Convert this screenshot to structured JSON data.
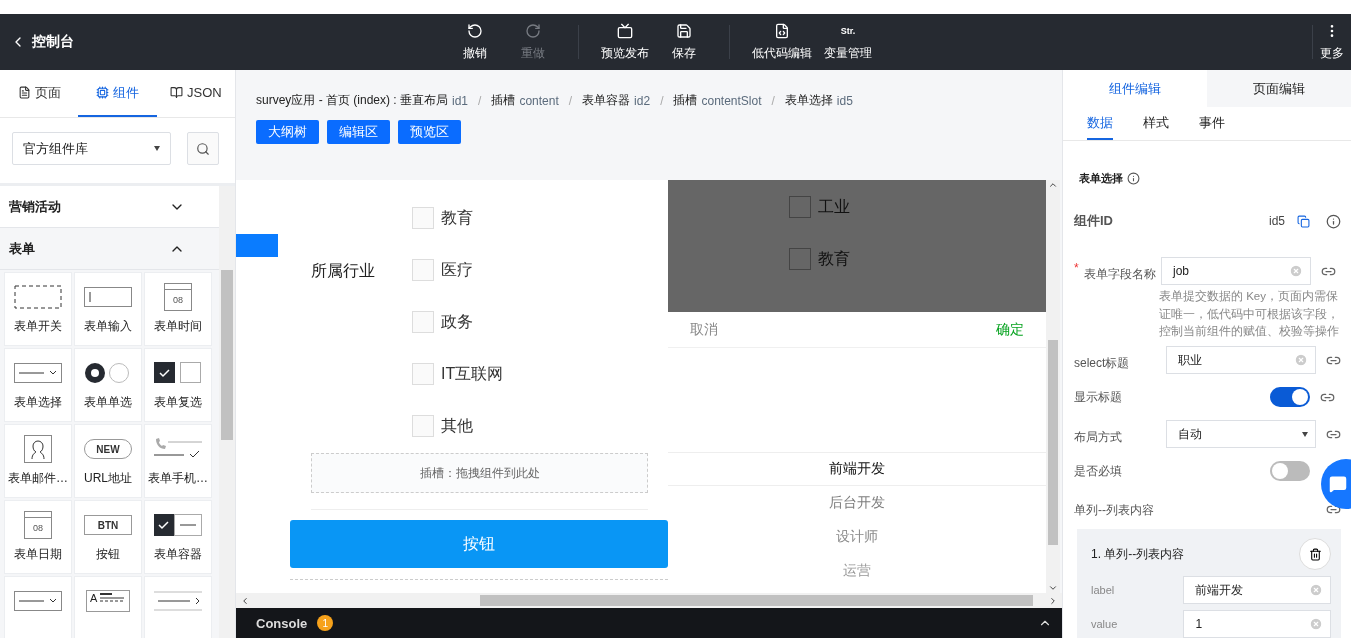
{
  "header": {
    "back": "控制台",
    "groups": [
      [
        {
          "label": "撤销",
          "kind": "undo",
          "disabled": false
        },
        {
          "label": "重做",
          "kind": "redo",
          "disabled": true
        }
      ],
      [
        {
          "label": "预览发布",
          "kind": "preview",
          "disabled": false
        },
        {
          "label": "保存",
          "kind": "save",
          "disabled": false
        }
      ],
      [
        {
          "label": "低代码编辑",
          "kind": "code",
          "disabled": false
        },
        {
          "label": "变量管理",
          "kind": "text",
          "glyph": "Str.",
          "disabled": false
        }
      ]
    ],
    "more": "更多"
  },
  "left_panel": {
    "tabs": [
      {
        "label": "页面",
        "kind": "page",
        "selected": false
      },
      {
        "label": "组件",
        "kind": "chip",
        "selected": true
      },
      {
        "label": "JSON",
        "kind": "book",
        "selected": false
      }
    ],
    "library": "官方组件库",
    "categories": [
      {
        "title": "营销活动",
        "expanded": false
      },
      {
        "title": "表单",
        "expanded": true
      }
    ],
    "components": [
      {
        "label": "表单开关",
        "kind": "dashed"
      },
      {
        "label": "表单输入",
        "kind": "input"
      },
      {
        "label": "表单时间",
        "kind": "calendar",
        "glyph": "08"
      },
      {
        "label": "表单选择",
        "kind": "select"
      },
      {
        "label": "表单单选",
        "kind": "radio"
      },
      {
        "label": "表单复选",
        "kind": "checkbox"
      },
      {
        "label": "表单邮件…",
        "kind": "person"
      },
      {
        "label": "URL地址",
        "kind": "pill",
        "glyph": "NEW"
      },
      {
        "label": "表单手机…",
        "kind": "phone"
      },
      {
        "label": "表单日期",
        "kind": "calendar",
        "glyph": "08"
      },
      {
        "label": "按钮",
        "kind": "btn",
        "glyph": "BTN"
      },
      {
        "label": "表单容器",
        "kind": "container"
      },
      {
        "kind": "select"
      },
      {
        "kind": "textarea",
        "glyph": "A"
      },
      {
        "kind": "arrowline"
      }
    ]
  },
  "breadcrumb": [
    {
      "name": "survey应用 - 首页 (index) : 垂直布局",
      "id": "id1"
    },
    {
      "sep": "/",
      "name": "插槽",
      "id": "content"
    },
    {
      "sep": "/",
      "name": "表单容器",
      "id": "id2"
    },
    {
      "sep": "/",
      "name": "插槽",
      "id": "contentSlot"
    },
    {
      "sep": "/",
      "name": "表单选择",
      "id": "id5"
    }
  ],
  "view_buttons": [
    "大纲树",
    "编辑区",
    "预览区"
  ],
  "form": {
    "label": "所属行业",
    "options": [
      {
        "label": "教育",
        "checked": false
      },
      {
        "label": "医疗",
        "checked": false
      },
      {
        "label": "政务",
        "checked": false
      },
      {
        "label": "IT互联网",
        "checked": false
      },
      {
        "label": "其他",
        "checked": false
      }
    ],
    "slot_hint": "插槽：拖拽组件到此处",
    "button": "按钮"
  },
  "preview": {
    "options": [
      {
        "label": "工业",
        "checked": false
      },
      {
        "label": "教育",
        "checked": false
      }
    ],
    "picker": {
      "cancel": "取消",
      "confirm": "确定",
      "options": [
        {
          "label": "前端开发",
          "selected": true
        },
        {
          "label": "后台开发",
          "selected": false
        },
        {
          "label": "设计师",
          "selected": false
        },
        {
          "label": "运营",
          "selected": false
        }
      ]
    }
  },
  "console": {
    "label": "Console",
    "count": "1"
  },
  "right_panel": {
    "tabs": [
      {
        "label": "组件编辑",
        "selected": true
      },
      {
        "label": "页面编辑",
        "selected": false
      }
    ],
    "sub_tabs": [
      {
        "label": "数据",
        "selected": true
      },
      {
        "label": "样式",
        "selected": false
      },
      {
        "label": "事件",
        "selected": false
      }
    ],
    "section_title": "表单选择",
    "component_id": {
      "label": "组件ID",
      "value": "id5"
    },
    "fields": [
      {
        "kind": "input",
        "label": "表单字段名称",
        "required": true,
        "required_mark": "*",
        "value": "job",
        "hint": "表单提交数据的 Key，页面内需保证唯一，低代码中可根据该字段，控制当前组件的赋值、校验等操作"
      },
      {
        "kind": "input",
        "label": "select标题",
        "required": false,
        "value": "职业"
      },
      {
        "kind": "switch",
        "label": "显示标题",
        "required": false,
        "on": true
      },
      {
        "kind": "select",
        "label": "布局方式",
        "required": false,
        "value": "自动"
      },
      {
        "kind": "switch",
        "label": "是否必填",
        "required": false,
        "on": false
      },
      {
        "kind": "header",
        "label": "单列--列表内容",
        "required": false
      }
    ],
    "list_items": [
      {
        "title": "1. 单列--列表内容",
        "props": [
          {
            "label": "label",
            "value": "前端开发"
          },
          {
            "label": "value",
            "value": "1"
          }
        ]
      }
    ]
  }
}
